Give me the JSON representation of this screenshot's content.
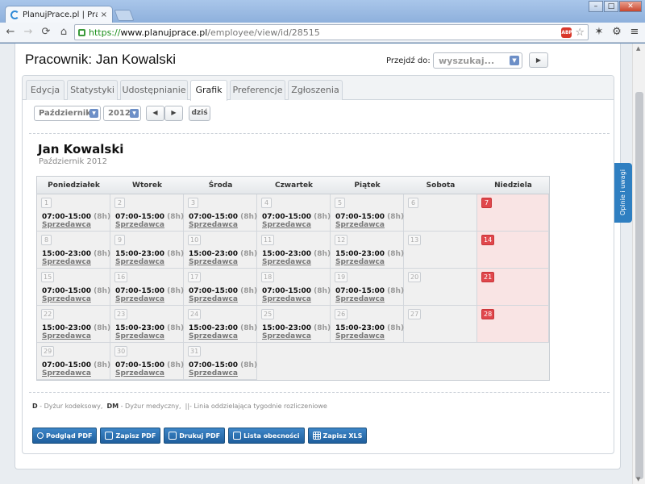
{
  "browser": {
    "tab_title": "PlanujPrace.pl | Pracownik: Ja",
    "tab_close": "×",
    "url_https": "https://",
    "url_host": "www.planujprace.pl",
    "url_path": "/employee/view/id/28515",
    "abp_label": "ABP",
    "window_buttons": [
      "–",
      "□",
      "✕"
    ]
  },
  "page": {
    "title": "Pracownik: Jan Kowalski",
    "goto_label": "Przejdź do:",
    "goto_placeholder": "wyszukaj..."
  },
  "tabs": [
    "Edycja",
    "Statystyki",
    "Udostępnianie",
    "Grafik",
    "Preferencje",
    "Zgłoszenia"
  ],
  "active_tab": "Grafik",
  "controls": {
    "month": "Październik",
    "year": "2012",
    "today": "dziś"
  },
  "employee": {
    "name": "Jan Kowalski",
    "period": "Październik 2012"
  },
  "calendar": {
    "weekdays": [
      "Poniedziałek",
      "Wtorek",
      "Środa",
      "Czwartek",
      "Piątek",
      "Sobota",
      "Niedziela"
    ],
    "weeks": [
      [
        {
          "day": "1",
          "shift": "07:00-15:00",
          "hours": "(8h)",
          "role": "Sprzedawca"
        },
        {
          "day": "2",
          "shift": "07:00-15:00",
          "hours": "(8h)",
          "role": "Sprzedawca"
        },
        {
          "day": "3",
          "shift": "07:00-15:00",
          "hours": "(8h)",
          "role": "Sprzedawca"
        },
        {
          "day": "4",
          "shift": "07:00-15:00",
          "hours": "(8h)",
          "role": "Sprzedawca"
        },
        {
          "day": "5",
          "shift": "07:00-15:00",
          "hours": "(8h)",
          "role": "Sprzedawca"
        },
        {
          "day": "6"
        },
        {
          "day": "7",
          "holiday": true
        }
      ],
      [
        {
          "day": "8",
          "shift": "15:00-23:00",
          "hours": "(8h)",
          "role": "Sprzedawca"
        },
        {
          "day": "9",
          "shift": "15:00-23:00",
          "hours": "(8h)",
          "role": "Sprzedawca"
        },
        {
          "day": "10",
          "shift": "15:00-23:00",
          "hours": "(8h)",
          "role": "Sprzedawca"
        },
        {
          "day": "11",
          "shift": "15:00-23:00",
          "hours": "(8h)",
          "role": "Sprzedawca"
        },
        {
          "day": "12",
          "shift": "15:00-23:00",
          "hours": "(8h)",
          "role": "Sprzedawca"
        },
        {
          "day": "13"
        },
        {
          "day": "14",
          "holiday": true
        }
      ],
      [
        {
          "day": "15",
          "shift": "07:00-15:00",
          "hours": "(8h)",
          "role": "Sprzedawca"
        },
        {
          "day": "16",
          "shift": "07:00-15:00",
          "hours": "(8h)",
          "role": "Sprzedawca"
        },
        {
          "day": "17",
          "shift": "07:00-15:00",
          "hours": "(8h)",
          "role": "Sprzedawca"
        },
        {
          "day": "18",
          "shift": "07:00-15:00",
          "hours": "(8h)",
          "role": "Sprzedawca"
        },
        {
          "day": "19",
          "shift": "07:00-15:00",
          "hours": "(8h)",
          "role": "Sprzedawca"
        },
        {
          "day": "20"
        },
        {
          "day": "21",
          "holiday": true
        }
      ],
      [
        {
          "day": "22",
          "shift": "15:00-23:00",
          "hours": "(8h)",
          "role": "Sprzedawca"
        },
        {
          "day": "23",
          "shift": "15:00-23:00",
          "hours": "(8h)",
          "role": "Sprzedawca"
        },
        {
          "day": "24",
          "shift": "15:00-23:00",
          "hours": "(8h)",
          "role": "Sprzedawca"
        },
        {
          "day": "25",
          "shift": "15:00-23:00",
          "hours": "(8h)",
          "role": "Sprzedawca"
        },
        {
          "day": "26",
          "shift": "15:00-23:00",
          "hours": "(8h)",
          "role": "Sprzedawca"
        },
        {
          "day": "27"
        },
        {
          "day": "28",
          "holiday": true
        }
      ],
      [
        {
          "day": "29",
          "shift": "07:00-15:00",
          "hours": "(8h)",
          "role": "Sprzedawca"
        },
        {
          "day": "30",
          "shift": "07:00-15:00",
          "hours": "(8h)",
          "role": "Sprzedawca"
        },
        {
          "day": "31",
          "shift": "07:00-15:00",
          "hours": "(8h)",
          "role": "Sprzedawca"
        }
      ]
    ]
  },
  "legend": {
    "d_key": "D",
    "d_text": " - Dyżur kodeksowy,",
    "dm_key": "DM",
    "dm_text": " - Dyżur medyczny,",
    "line_text": "||- Linia oddzielająca tygodnie rozliczeniowe"
  },
  "actions": [
    "Podgląd PDF",
    "Zapisz PDF",
    "Drukuj PDF",
    "Lista obecności",
    "Zapisz XLS"
  ],
  "feedback_label": "Opinie i uwagi",
  "colors": {
    "accent": "#2a6fb3",
    "holiday": "#e0474c",
    "holiday_bg": "#f9e4e4"
  }
}
